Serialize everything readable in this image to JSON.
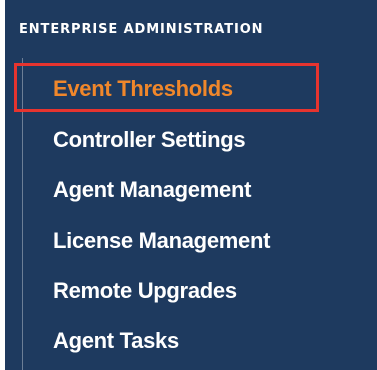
{
  "section": {
    "title": "ENTERPRISE ADMINISTRATION"
  },
  "nav": {
    "items": [
      {
        "label": "Event Thresholds",
        "active": true
      },
      {
        "label": "Controller Settings",
        "active": false
      },
      {
        "label": "Agent Management",
        "active": false
      },
      {
        "label": "License Management",
        "active": false
      },
      {
        "label": "Remote Upgrades",
        "active": false
      },
      {
        "label": "Agent Tasks",
        "active": false
      }
    ]
  },
  "colors": {
    "panel_background": "#1e3a5f",
    "active_text": "#f0872b",
    "highlight_border": "#e6342f",
    "text": "#ffffff"
  }
}
